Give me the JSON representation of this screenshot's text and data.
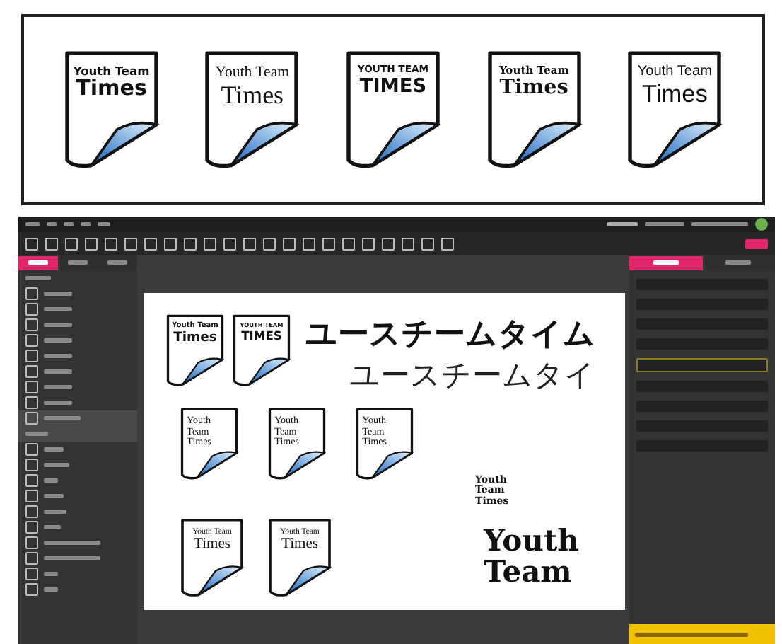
{
  "logo_sheet": [
    {
      "kind": "sans",
      "lines": [
        "Youth Team",
        "Times"
      ]
    },
    {
      "kind": "serif",
      "lines": [
        "Youth Team",
        "Times"
      ]
    },
    {
      "kind": "heavy",
      "lines": [
        "YOUTH TEAM",
        "TIMES"
      ]
    },
    {
      "kind": "slab",
      "lines": [
        "Youth Team",
        "Times"
      ]
    },
    {
      "kind": "light",
      "lines": [
        "Youth Team",
        "Times"
      ]
    }
  ],
  "editor": {
    "left_tabs": [
      {
        "selected": true
      },
      {
        "selected": false
      },
      {
        "selected": false
      }
    ],
    "pages": [
      {
        "selected": false
      },
      {
        "selected": false
      },
      {
        "selected": false
      },
      {
        "selected": false
      },
      {
        "selected": false
      },
      {
        "selected": false
      },
      {
        "selected": false
      },
      {
        "selected": false
      },
      {
        "selected": true
      }
    ],
    "right_tabs": [
      {
        "selected": true
      },
      {
        "selected": false
      }
    ],
    "canvas": {
      "top_logos": [
        {
          "kind": "sans",
          "lines": [
            "Youth Team",
            "Times"
          ]
        },
        {
          "kind": "heavy",
          "lines": [
            "YOUTH TEAM",
            "TIMES"
          ]
        }
      ],
      "heading_bold": "ユースチームタイム",
      "heading_light": "ユースチームタイ",
      "small_logos": [
        {
          "kind": "serif",
          "lines": [
            "Youth",
            "Team",
            "Times"
          ]
        },
        {
          "kind": "serif",
          "lines": [
            "Youth",
            "Team",
            "Times"
          ]
        },
        {
          "kind": "serif",
          "lines": [
            "Youth",
            "Team",
            "Times"
          ]
        }
      ],
      "caps_logos": [
        {
          "kind": "caps",
          "lines": [
            "Youth Team",
            "Times"
          ]
        },
        {
          "kind": "caps",
          "lines": [
            "Youth Team",
            "Times"
          ]
        }
      ],
      "small_text": [
        "Youth",
        "Team",
        "Times"
      ],
      "big_text": [
        "Youth",
        "Team"
      ]
    }
  }
}
